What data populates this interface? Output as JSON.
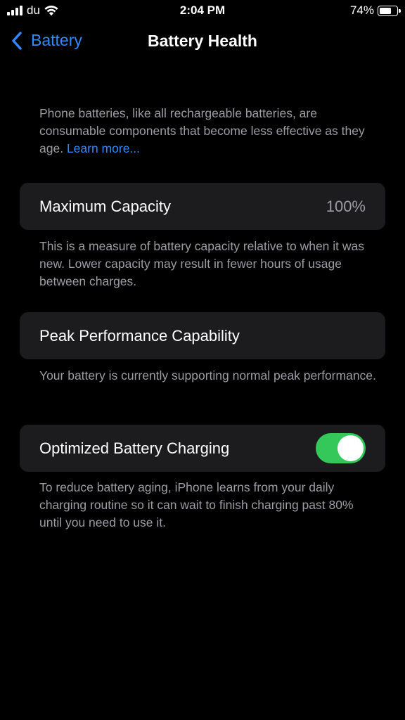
{
  "status_bar": {
    "carrier": "du",
    "time": "2:04 PM",
    "battery_percent": "74%",
    "battery_level": 0.74,
    "signal_icon": "signal-bars-icon",
    "wifi_icon": "wifi-icon",
    "battery_icon": "battery-icon"
  },
  "nav": {
    "back_label": "Battery",
    "back_icon": "chevron-left-icon",
    "title": "Battery Health"
  },
  "intro": {
    "text": "Phone batteries, like all rechargeable batteries, are consumable components that become less effective as they age. ",
    "link": "Learn more..."
  },
  "maximum_capacity": {
    "label": "Maximum Capacity",
    "value": "100%",
    "footer": "This is a measure of battery capacity relative to when it was new. Lower capacity may result in fewer hours of usage between charges."
  },
  "peak_performance": {
    "label": "Peak Performance Capability",
    "footer": "Your battery is currently supporting normal peak performance."
  },
  "optimized_charging": {
    "label": "Optimized Battery Charging",
    "enabled": true,
    "footer": "To reduce battery aging, iPhone learns from your daily charging routine so it can wait to finish charging past 80% until you need to use it."
  },
  "colors": {
    "background": "#000000",
    "cell_background": "#1c1c1e",
    "accent": "#2f8bff",
    "secondary_text": "#9c9ca3",
    "toggle_on": "#34c759"
  }
}
